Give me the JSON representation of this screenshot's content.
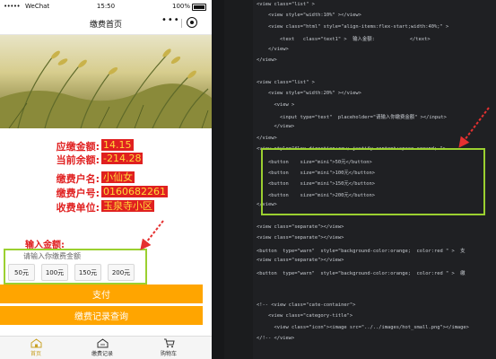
{
  "status_bar": {
    "signal": "•••••",
    "carrier": "WeChat",
    "time": "15:50",
    "battery": "100%"
  },
  "header": {
    "title": "缴费首页",
    "more_icon": "more-dots-icon",
    "close_icon": "target-close-icon"
  },
  "banner": {
    "image": "rice-field-photo"
  },
  "payment_info": [
    {
      "label": "应缴金额:",
      "value": "14.15"
    },
    {
      "label": "当前余额:",
      "value": "-214.28"
    },
    {
      "label": "缴费户名:",
      "value": "小仙女"
    },
    {
      "label": "缴费户号:",
      "value": "0160682261"
    },
    {
      "label": "收费单位:",
      "value": "玉泉寺小区"
    }
  ],
  "amount": {
    "label": "输入金额:",
    "placeholder": "请输入你缴费金额",
    "value": "",
    "quick_buttons": [
      "50元",
      "100元",
      "150元",
      "200元"
    ]
  },
  "buttons": {
    "pay": "支付",
    "records": "缴费记录查询"
  },
  "tabbar": [
    {
      "label": "首页",
      "icon": "home-icon",
      "active": true
    },
    {
      "label": "缴费记录",
      "icon": "record-house-icon",
      "active": false
    },
    {
      "label": "购物车",
      "icon": "cart-icon",
      "active": false
    }
  ],
  "editor": {
    "line_numbers": [
      "",
      "",
      "",
      "",
      "",
      "",
      "",
      "",
      "",
      "",
      "",
      "",
      "",
      "",
      "",
      "",
      "",
      "",
      "",
      "",
      "",
      "",
      "",
      "",
      "",
      "",
      "",
      "",
      "",
      "",
      "",
      "",
      "",
      ""
    ],
    "lines": [
      "<view class=\"list\" >",
      "    <view style=\"width:10%\" ></view>",
      "    <view class=\"html\" style=\"align-items:flex-start;width:40%;\" >",
      "        <text   class=\"text1\" >  输入金额:            </text>",
      "    </view>",
      "</view>",
      "",
      "<view class=\"list\" >",
      "    <view style=\"width:20%\" ></view>",
      "      <view >",
      "        <input type=\"text\"  placeholder=\"请输入你缴费金额\" ></input>",
      "      </view>",
      "</view>",
      "<view style=\"flex-direction:row; justify-content:space-around; \">",
      "    <button    size=\"mini\">50元</button>",
      "    <button    size=\"mini\">100元</button>",
      "    <button    size=\"mini\">150元</button>",
      "    <button    size=\"mini\">200元</button>",
      "</view>",
      "",
      "<view class=\"separate\"></view>",
      "<view class=\"separate\"></view>",
      "<button  type=\"warn\"  style=\"background-color:orange;  color:red \" >  支",
      "<view class=\"separate\"></view>",
      "<button  type=\"warn\"  style=\"background-color:orange;  color:red \" >  缴",
      "",
      "",
      "<!-- <view class=\"cate-container\">",
      "    <view class=\"category-title\">",
      "      <view class=\"icon\"><image src=\"../../images/hot_small.png\"></image>"
    ],
    "comment_tail": "</!-- </view>"
  }
}
